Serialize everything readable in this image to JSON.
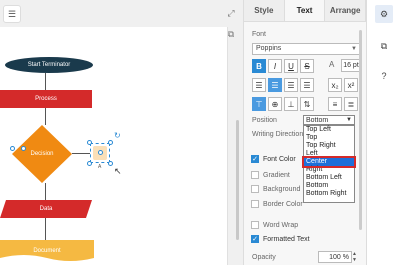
{
  "canvas": {
    "shapes": {
      "terminator": "Start Terminator",
      "process": "Process",
      "decision": "Decision",
      "data": "Data",
      "document": "Document"
    },
    "selected_anchor_label": "A"
  },
  "panel": {
    "tabs": [
      {
        "label": "Style"
      },
      {
        "label": "Text"
      },
      {
        "label": "Arrange"
      }
    ],
    "font": {
      "section_label": "Font",
      "family": "Poppins",
      "size": "16 pt"
    },
    "position": {
      "label": "Position",
      "selected": "Bottom",
      "options": [
        "Top Left",
        "Top",
        "Top Right",
        "Left",
        "Center",
        "Right",
        "Bottom Left",
        "Bottom",
        "Bottom Right"
      ],
      "highlighted": "Center"
    },
    "writing_direction_label": "Writing Direction",
    "options": {
      "font_color": "Font Color",
      "gradient": "Gradient",
      "background": "Background",
      "border_color": "Border Color",
      "word_wrap": "Word Wrap",
      "formatted_text": "Formatted Text"
    },
    "opacity": {
      "label": "Opacity",
      "value": "100 %"
    }
  },
  "colors": {
    "accent": "#2a8ad4",
    "terminator": "#1a3a4c",
    "process": "#d42a2a",
    "decision": "#f08a12",
    "data": "#d42a2a",
    "document": "#f5b942"
  }
}
